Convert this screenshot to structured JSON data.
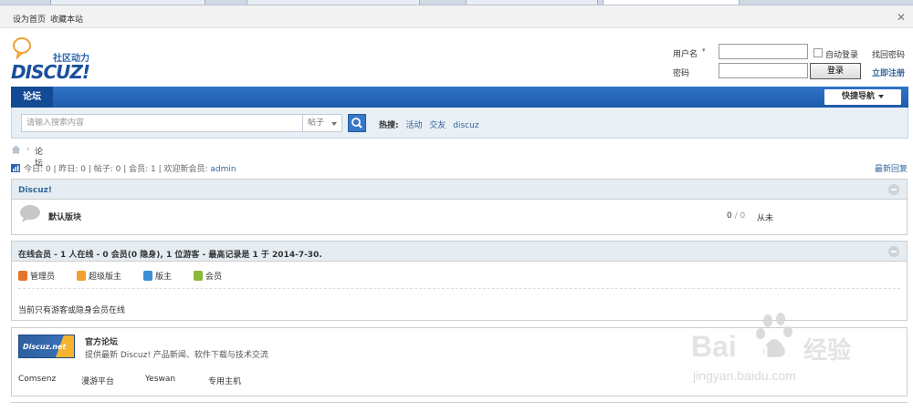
{
  "toolbar": {
    "set_home": "设为首页",
    "bookmark": "收藏本站"
  },
  "logo": {
    "brand": "DISCUZ!",
    "tagline": "社区动力"
  },
  "login": {
    "username_label": "用户名",
    "password_label": "密码",
    "auto_login": "自动登录",
    "retrieve_password": "找回密码",
    "login_button": "登录",
    "register": "立即注册"
  },
  "nav": {
    "tab_forum": "论坛",
    "quick_nav": "快捷导航"
  },
  "search": {
    "placeholder": "请输入搜索内容",
    "type": "帖子",
    "hot_label": "热搜:",
    "hot_terms": [
      "活动",
      "交友",
      "discuz"
    ]
  },
  "breadcrumb": {
    "current": "论坛"
  },
  "stats": {
    "text": "今日: 0 | 昨日: 0 | 帖子: 0 | 会员: 1 | 欢迎新会员: ",
    "new_member": "admin",
    "latest_reply": "最新回复"
  },
  "category": {
    "title": "Discuz!",
    "forum_name": "默认版块",
    "threads": "0",
    "posts": "0",
    "last_post": "从未"
  },
  "online": {
    "title": "在线会员 - 1 人在线 - 0 会员(0 隐身), 1 位游客 - 最高记录是 1 于 2014-7-30.",
    "legend": [
      "管理员",
      "超级版主",
      "版主",
      "会员"
    ],
    "legend_colors": [
      "#e8742c",
      "#f0a030",
      "#3a8fd6",
      "#8cb83a"
    ],
    "note": "当前只有游客或隐身会员在线"
  },
  "links": {
    "badge": "Discuz.net",
    "title": "官方论坛",
    "desc": "提供最新 Discuz! 产品新闻、软件下载与技术交流",
    "items": [
      "Comsenz",
      "漫游平台",
      "Yeswan",
      "专用主机"
    ]
  },
  "watermark": {
    "brand": "Bai",
    "brand2": "du",
    "cn": "经验",
    "url": "jingyan.baidu.com"
  }
}
